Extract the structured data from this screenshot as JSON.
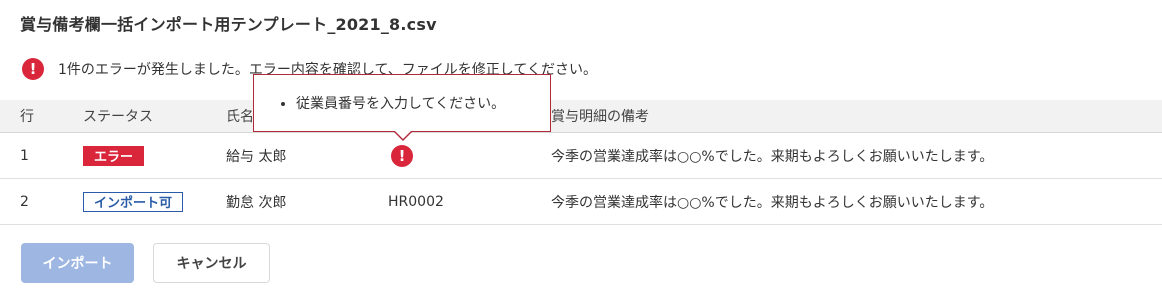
{
  "title": "賞与備考欄一括インポート用テンプレート_2021_8.csv",
  "error_banner": {
    "icon": "exclamation-circle-icon",
    "text": "1件のエラーが発生しました。エラー内容を確認して、ファイルを修正してください。",
    "color": "#d9263b"
  },
  "table": {
    "headers": {
      "row": "行",
      "status": "ステータス",
      "name": "氏名",
      "note": "賞与明細の備考"
    },
    "rows": [
      {
        "row": "1",
        "status": "エラー",
        "name": "給与 太郎",
        "employee_no": "",
        "note": "今季の営業達成率は○○%でした。来期もよろしくお願いいたします。"
      },
      {
        "row": "2",
        "status": "インポート可",
        "name": "勤怠 次郎",
        "employee_no": "HR0002",
        "note": "今季の営業達成率は○○%でした。来期もよろしくお願いいたします。"
      }
    ]
  },
  "tooltip": {
    "items": [
      "従業員番号を入力してください。"
    ]
  },
  "buttons": {
    "import": "インポート",
    "cancel": "キャンセル"
  },
  "colors": {
    "error": "#d9263b",
    "ok_badge": "#2a5ca8",
    "import_button_disabled": "#9eb6e2"
  }
}
